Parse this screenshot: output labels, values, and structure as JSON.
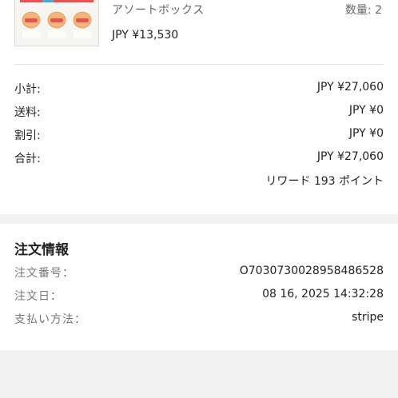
{
  "product": {
    "name": "アソートボックス",
    "quantity": "数量: 2",
    "price": "JPY ¥13,530"
  },
  "summary": [
    {
      "label": "小計:",
      "value": "JPY ¥27,060"
    },
    {
      "label": "送料:",
      "value": "JPY ¥0"
    },
    {
      "label": "割引:",
      "value": "JPY ¥0"
    },
    {
      "label": "合計:",
      "value": "JPY ¥27,060"
    }
  ],
  "reward": "リワード 193 ポイント",
  "order_info": {
    "title": "注文情報",
    "rows": [
      {
        "label": "注文番号：",
        "value": "O7030730028958486528"
      },
      {
        "label": "注文日：",
        "value": "08 16, 2025 14:32:28"
      },
      {
        "label": "支払い方法：",
        "value": "stripe"
      }
    ]
  },
  "colors": {
    "page_background": "#f2f2f2",
    "card_background": "#ffffff",
    "thumb_accent": "#e9534f"
  }
}
